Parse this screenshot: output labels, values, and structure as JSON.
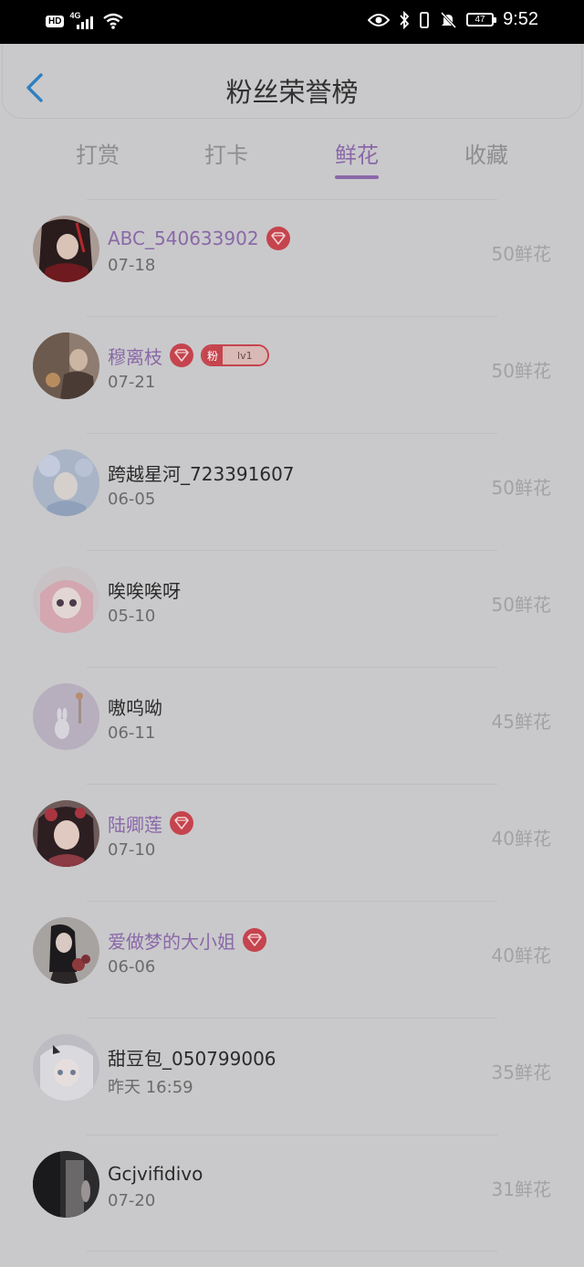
{
  "status_bar": {
    "hd": "HD",
    "network": "4G",
    "battery": "47",
    "time": "9:52"
  },
  "header": {
    "title": "粉丝荣誉榜"
  },
  "tabs": [
    {
      "label": "打赏"
    },
    {
      "label": "打卡"
    },
    {
      "label": "鲜花"
    },
    {
      "label": "收藏"
    }
  ],
  "active_tab": "鲜花",
  "fan_badge": {
    "left": "粉",
    "right": "lv1"
  },
  "rows": [
    {
      "name": "ABC_540633902",
      "date": "07-18",
      "amount": "50鲜花",
      "vip": true,
      "badge": false
    },
    {
      "name": "穆离枝",
      "date": "07-21",
      "amount": "50鲜花",
      "vip": true,
      "badge": true
    },
    {
      "name": "跨越星河_723391607",
      "date": "06-05",
      "amount": "50鲜花",
      "vip": false,
      "badge": false
    },
    {
      "name": "唉唉唉呀",
      "date": "05-10",
      "amount": "50鲜花",
      "vip": false,
      "badge": false
    },
    {
      "name": "嗷呜呦",
      "date": "06-11",
      "amount": "45鲜花",
      "vip": false,
      "badge": false
    },
    {
      "name": "陆卿莲",
      "date": "07-10",
      "amount": "40鲜花",
      "vip": true,
      "badge": false
    },
    {
      "name": "爱做梦的大小姐",
      "date": "06-06",
      "amount": "40鲜花",
      "vip": true,
      "badge": false
    },
    {
      "name": "甜豆包_050799006",
      "date": "昨天 16:59",
      "amount": "35鲜花",
      "vip": false,
      "badge": false
    },
    {
      "name": "Gcjvifidivo",
      "date": "07-20",
      "amount": "31鲜花",
      "vip": false,
      "badge": false
    }
  ],
  "colors": {
    "accent": "#8a68a8",
    "vip_gem": "#c5444d",
    "background": "#c9c9cb"
  }
}
